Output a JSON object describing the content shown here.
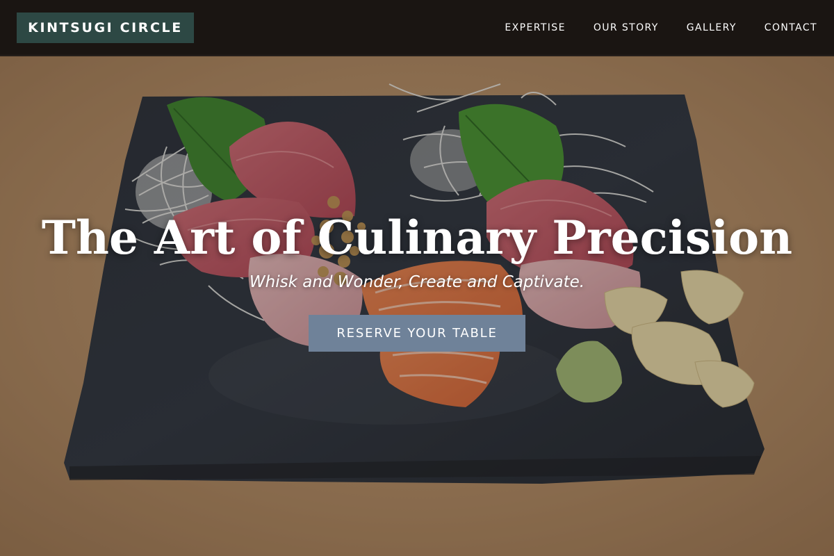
{
  "header": {
    "brand": "KINTSUGI CIRCLE",
    "nav": [
      "EXPERTISE",
      "OUR STORY",
      "GALLERY",
      "CONTACT"
    ]
  },
  "hero": {
    "title": "The Art of Culinary Precision",
    "subtitle": "Whisk and Wonder, Create and Captivate.",
    "cta": "RESERVE YOUR TABLE"
  },
  "colors": {
    "header_bg": "#1a1512",
    "brand_bg": "#2d4844",
    "cta_bg": "#6f8299",
    "text": "#ffffff"
  }
}
